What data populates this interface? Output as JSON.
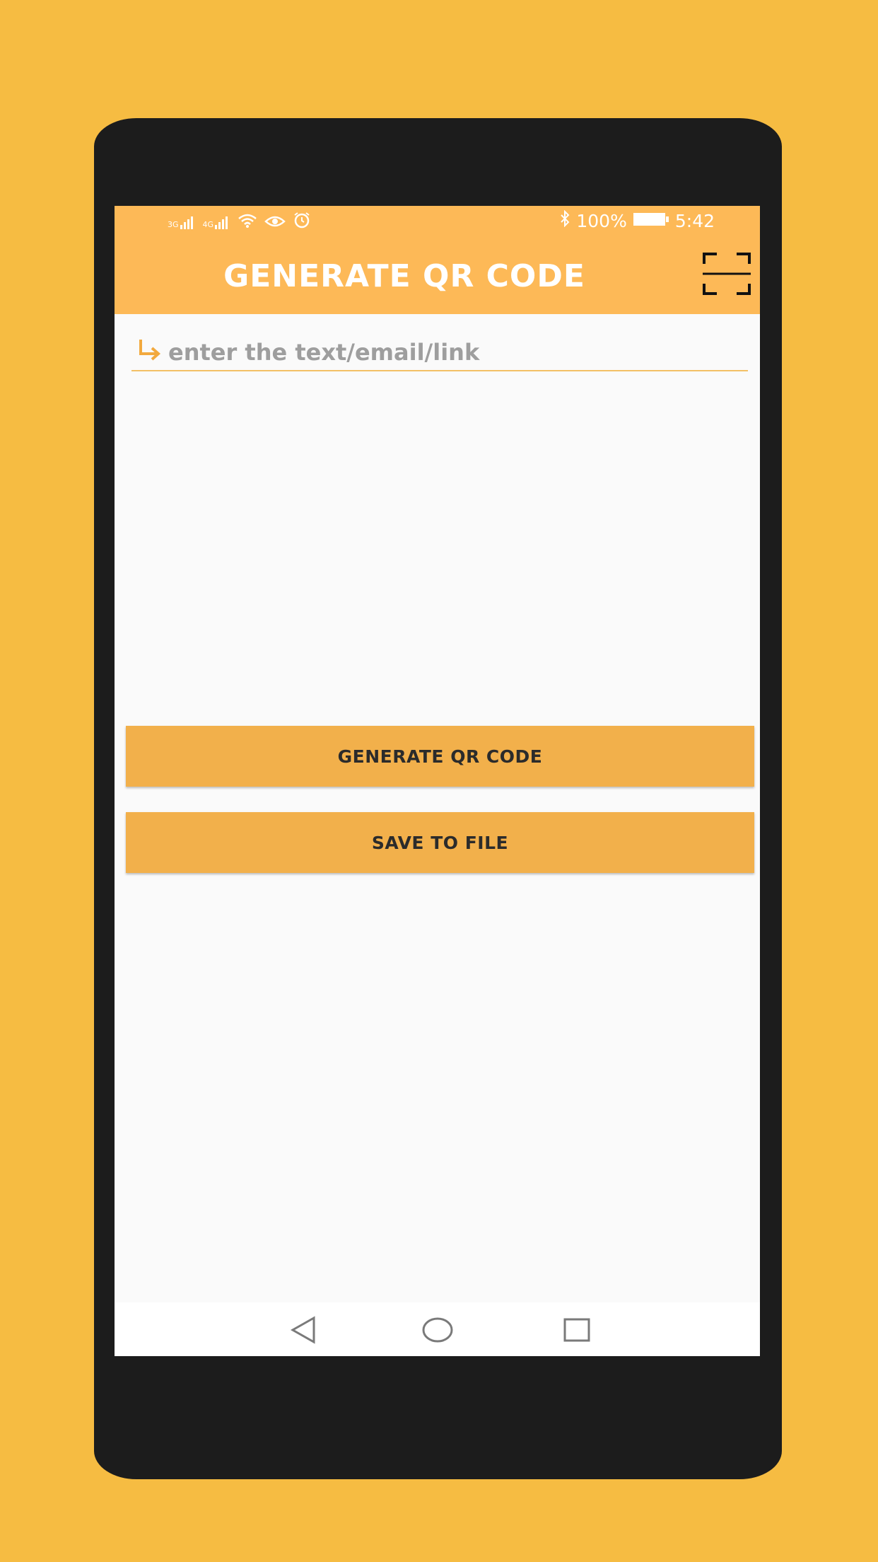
{
  "status_bar": {
    "signal_left": "3G",
    "signal_right": "4G",
    "battery": "100%",
    "time": "5:42"
  },
  "app_bar": {
    "title": "GENERATE QR CODE"
  },
  "input": {
    "placeholder": "enter the text/email/link",
    "value": ""
  },
  "buttons": {
    "generate_label": "GENERATE QR CODE",
    "save_label": "SAVE TO FILE"
  },
  "icons": [
    "signal-3g-icon",
    "signal-4g-icon",
    "wifi-icon",
    "eye-icon",
    "alarm-icon",
    "bluetooth-icon",
    "battery-icon",
    "scan-icon",
    "arrow-return-icon",
    "back-nav-icon",
    "home-nav-icon",
    "recents-nav-icon"
  ],
  "colors": {
    "background": "#F6BC42",
    "phone_body": "#1C1C1C",
    "app_bar": "#FDB957",
    "button": "#F2B04B",
    "screen": "#FAFAFA"
  }
}
